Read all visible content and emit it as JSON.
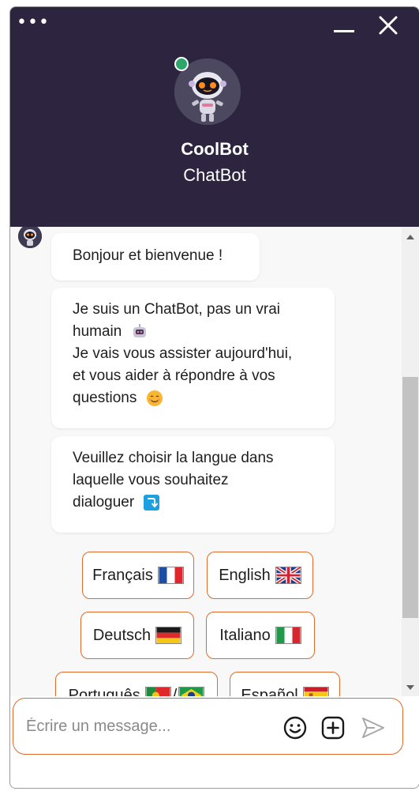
{
  "header": {
    "bot_name": "CoolBot",
    "bot_role": "ChatBot",
    "status": "online"
  },
  "messages": [
    {
      "text": "Bonjour et bienvenue !"
    },
    {
      "lines": [
        "Je suis un ChatBot, pas un vrai",
        "humain",
        "Je vais vous assister aujourd'hui,",
        "et vous aider à répondre à vos",
        "questions"
      ]
    },
    {
      "lines": [
        "Veuillez choisir la langue dans",
        "laquelle vous souhaitez",
        "dialoguer"
      ]
    }
  ],
  "languages": [
    {
      "label": "Français",
      "flag": "flag-france-icon"
    },
    {
      "label": "English",
      "flag": "flag-uk-icon"
    },
    {
      "label": "Deutsch",
      "flag": "flag-germany-icon"
    },
    {
      "label": "Italiano",
      "flag": "flag-italy-icon"
    },
    {
      "label": "Português",
      "separator": "/",
      "flag": "flag-portugal-brazil-icon"
    },
    {
      "label": "Español",
      "flag": "flag-spain-icon"
    }
  ],
  "composer": {
    "placeholder": "Écrire un message..."
  },
  "colors": {
    "header_bg": "#2d2540",
    "accent": "#e06a2a",
    "online": "#2ca66b"
  }
}
